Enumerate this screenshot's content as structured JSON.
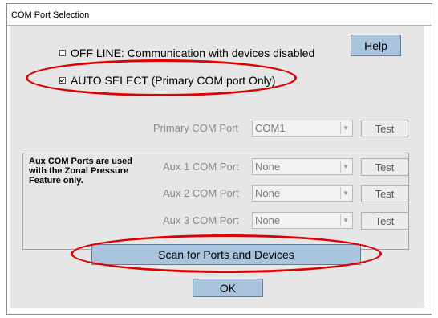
{
  "window": {
    "title": "COM Port Selection"
  },
  "options": {
    "offline_label": "OFF LINE: Communication with devices disabled",
    "offline_checked": false,
    "autoselect_label": "AUTO SELECT  (Primary COM port Only)",
    "autoselect_checked": true
  },
  "help_label": "Help",
  "primary": {
    "label": "Primary COM Port",
    "value": "COM1",
    "test_label": "Test"
  },
  "aux_note": "Aux COM Ports are used with the Zonal Pressure Feature only.",
  "aux_ports": [
    {
      "label": "Aux 1 COM Port",
      "value": "None",
      "test_label": "Test"
    },
    {
      "label": "Aux 2 COM Port",
      "value": "None",
      "test_label": "Test"
    },
    {
      "label": "Aux 3 COM Port",
      "value": "None",
      "test_label": "Test"
    }
  ],
  "scan_label": "Scan for Ports and Devices",
  "ok_label": "OK",
  "colors": {
    "highlight": "#e00000",
    "button_blue": "#a9c4dc",
    "background": "#e6e6e6"
  }
}
